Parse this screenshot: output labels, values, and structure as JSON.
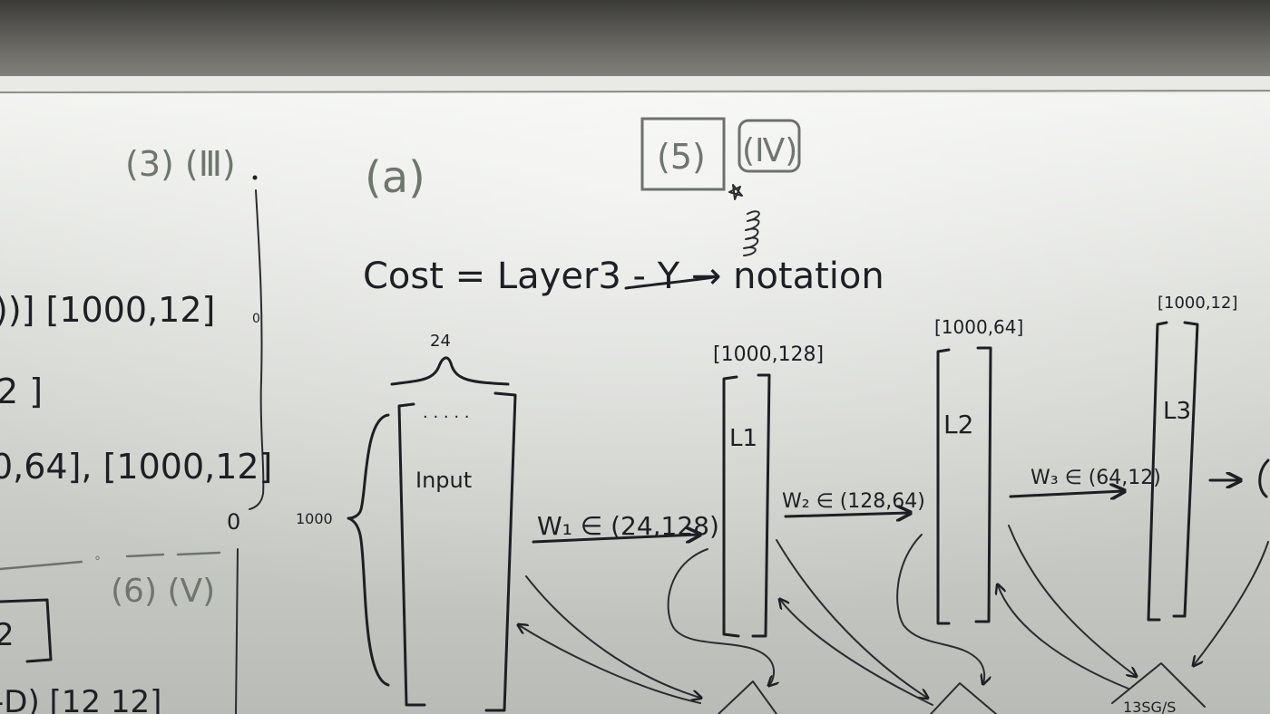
{
  "ink_color": "#1d1f24",
  "faint_ink_color": "#6f766d",
  "board_color": "#d4d6d1",
  "labels": {
    "part_a": "(a)",
    "part_5": "(5)",
    "part_iv": "(Ⅳ)",
    "part_3": "(3) (Ⅲ)",
    "part_6": "(6) (Ⅴ)",
    "cost_line": "Cost = Layer3 - Y → notation",
    "input_width": "24",
    "input_height": "1000",
    "input_dots": "· · · · ·",
    "input": "Input",
    "l1": "L1",
    "l2": "L2",
    "l3": "L3",
    "l1_shape": "[1000,128]",
    "l2_shape": "[1000,64]",
    "l3_shape": "[1000,12]",
    "w1": "W₁ ∈ (24,128)",
    "w2": "W₂ ∈ (128,64)",
    "w3": "W₃ ∈ (64,12)",
    "left_1": "))] [1000,12]",
    "left_2": "2 ]",
    "left_3": "0,64], [1000,12]",
    "left_4": "2",
    "left_5": "-D) [12 12]",
    "zero_1": "0",
    "zero_2": "0",
    "bottom_right": "13SG/S"
  }
}
